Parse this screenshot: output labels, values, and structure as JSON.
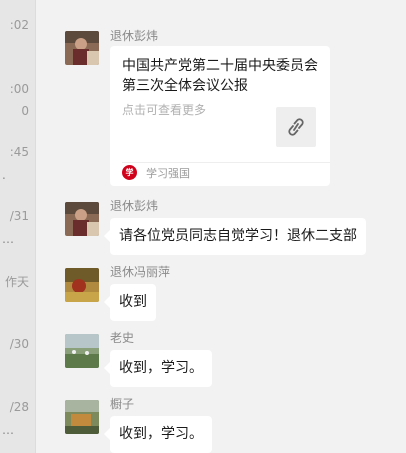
{
  "conversation_list": {
    "times": [
      ":02",
      ":00",
      "0",
      ":45",
      ".",
      "/31",
      "…",
      "作天",
      "/30",
      "/28",
      "…"
    ]
  },
  "messages": [
    {
      "sender": "退休彭炜",
      "type": "article",
      "article": {
        "title": "中国共产党第二十届中央委员会第三次全体会议公报",
        "action": "点击可查看更多",
        "link_icon": "link-icon",
        "source_logo_text": "学",
        "source_name": "学习强国"
      }
    },
    {
      "sender": "退休彭炜",
      "type": "text",
      "text": "请各位党员同志自觉学习！退休二支部"
    },
    {
      "sender": "退休冯丽萍",
      "type": "text",
      "text": "收到"
    },
    {
      "sender": "老史",
      "type": "text",
      "text": "收到，学习。"
    },
    {
      "sender": "橱子",
      "type": "text",
      "text": "收到，学习。"
    }
  ],
  "colors": {
    "background": "#f2f2f2",
    "bubble": "#ffffff",
    "source_logo": "#d0021b"
  }
}
